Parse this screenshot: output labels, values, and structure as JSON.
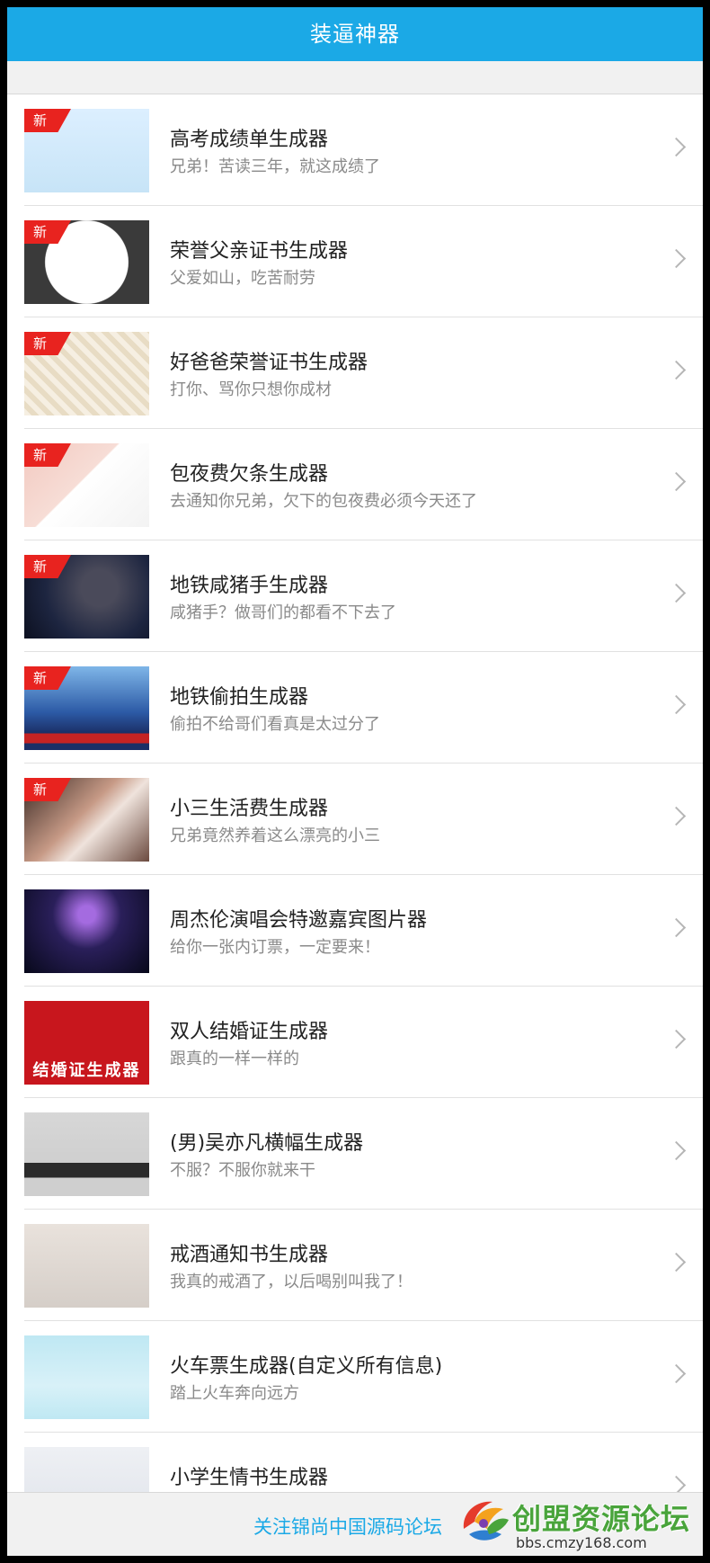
{
  "header": {
    "title": "装逼神器"
  },
  "items": [
    {
      "title": "高考成绩单生成器",
      "desc": "兄弟！苦读三年，就这成绩了",
      "badge": "新",
      "thumb": "gaokao-score-thumb",
      "thumb_text": ""
    },
    {
      "title": "荣誉父亲证书生成器",
      "desc": "父爱如山，吃苦耐劳",
      "badge": "新",
      "thumb": "honor-father-thumb",
      "thumb_text": ""
    },
    {
      "title": "好爸爸荣誉证书生成器",
      "desc": "打你、骂你只想你成材",
      "badge": "新",
      "thumb": "good-dad-thumb",
      "thumb_text": ""
    },
    {
      "title": "包夜费欠条生成器",
      "desc": "去通知你兄弟，欠下的包夜费必须今天还了",
      "badge": "新",
      "thumb": "iou-thumb",
      "thumb_text": ""
    },
    {
      "title": "地铁咸猪手生成器",
      "desc": "咸猪手？做哥们的都看不下去了",
      "badge": "新",
      "thumb": "subway-groper-thumb",
      "thumb_text": ""
    },
    {
      "title": "地铁偷拍生成器",
      "desc": "偷拍不给哥们看真是太过分了",
      "badge": "新",
      "thumb": "subway-candid-thumb",
      "thumb_text": ""
    },
    {
      "title": "小三生活费生成器",
      "desc": "兄弟竟然养着这么漂亮的小三",
      "badge": "新",
      "thumb": "mistress-thumb",
      "thumb_text": ""
    },
    {
      "title": "周杰伦演唱会特邀嘉宾图片器",
      "desc": "给你一张内订票，一定要来！",
      "badge": "",
      "thumb": "concert-thumb",
      "thumb_text": ""
    },
    {
      "title": "双人结婚证生成器",
      "desc": "跟真的一样一样的",
      "badge": "",
      "thumb": "marriage-cert-thumb",
      "thumb_text": "结婚证生成器"
    },
    {
      "title": "(男)吴亦凡横幅生成器",
      "desc": "不服？不服你就来干",
      "badge": "",
      "thumb": "banner-thumb",
      "thumb_text": ""
    },
    {
      "title": "戒酒通知书生成器",
      "desc": "我真的戒酒了，以后喝别叫我了！",
      "badge": "",
      "thumb": "quit-drinking-thumb",
      "thumb_text": ""
    },
    {
      "title": "火车票生成器(自定义所有信息)",
      "desc": "踏上火车奔向远方",
      "badge": "",
      "thumb": "train-ticket-thumb",
      "thumb_text": ""
    },
    {
      "title": "小学生情书生成器",
      "desc": "",
      "badge": "",
      "thumb": "love-letter-thumb",
      "thumb_text": ""
    }
  ],
  "footer": {
    "link": "关注锦尚中国源码论坛"
  },
  "watermark": {
    "title": "创盟资源论坛",
    "url": "bbs.cmzy168.com"
  },
  "colors": {
    "header_bg": "#1ba9e6",
    "badge_bg": "#e8231f",
    "link": "#1ba9e6"
  }
}
